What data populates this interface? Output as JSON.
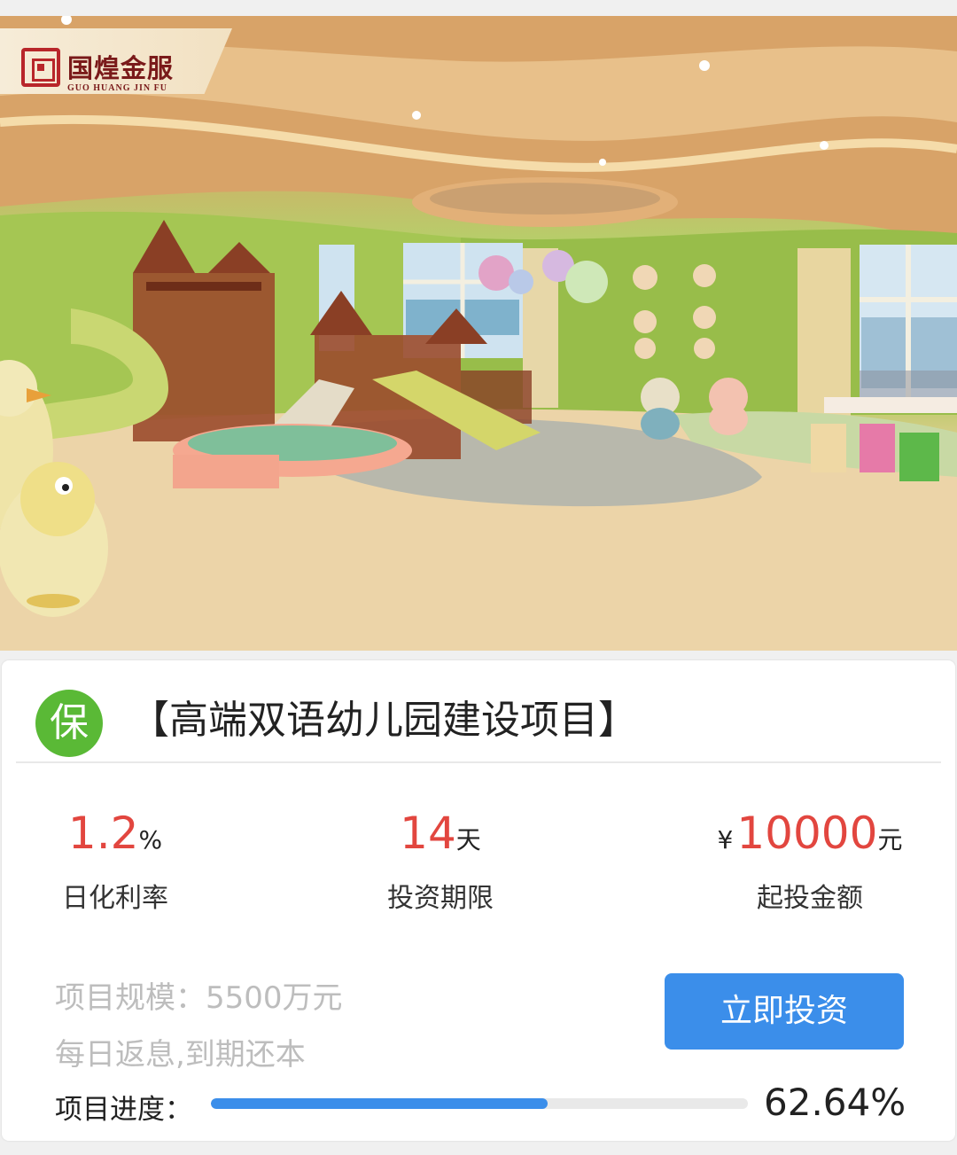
{
  "brand": {
    "name_cn": "国煌金服",
    "name_en": "GUO HUANG JIN FU"
  },
  "hero": {
    "image_desc_icon": "kindergarten-playroom-image"
  },
  "project": {
    "badge": "保",
    "title": "【高端双语幼儿园建设项目】",
    "stats": {
      "rate_value": "1.2",
      "rate_unit": "%",
      "rate_label": "日化利率",
      "term_value": "14",
      "term_unit": "天",
      "term_label": "投资期限",
      "min_prefix": "¥",
      "min_value": "10000",
      "min_unit": "元",
      "min_label": "起投金额"
    },
    "scale": "项目规模：5500万元",
    "repay": "每日返息,到期还本",
    "invest_button": "立即投资",
    "progress_label": "项目进度：",
    "progress_text": "62.64%",
    "progress_fraction": 0.6264
  },
  "colors": {
    "accent_blue": "#3b8eea",
    "rate_red": "#e2463f",
    "badge_green": "#5ab936",
    "muted_gray": "#bdbdbd"
  }
}
